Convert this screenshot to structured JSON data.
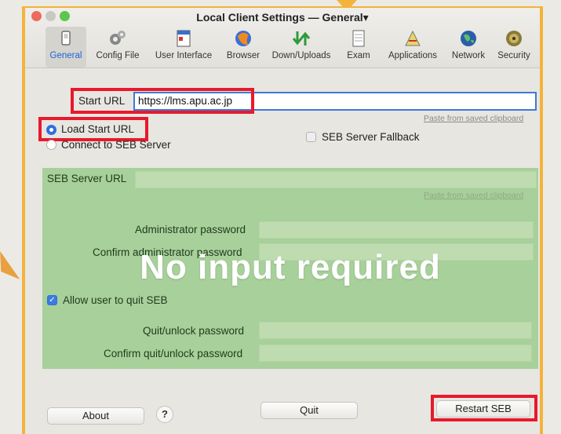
{
  "window": {
    "title": "Local Client Settings — General▾"
  },
  "toolbar": {
    "items": [
      {
        "label": "General",
        "icon": "general-icon",
        "active": true
      },
      {
        "label": "Config File",
        "icon": "config-file-icon"
      },
      {
        "label": "User Interface",
        "icon": "user-interface-icon"
      },
      {
        "label": "Browser",
        "icon": "browser-icon"
      },
      {
        "label": "Down/Uploads",
        "icon": "down-uploads-icon"
      },
      {
        "label": "Exam",
        "icon": "exam-icon"
      },
      {
        "label": "Applications",
        "icon": "applications-icon"
      },
      {
        "label": "Network",
        "icon": "network-icon"
      },
      {
        "label": "Security",
        "icon": "security-icon"
      }
    ]
  },
  "general": {
    "start_url_label": "Start URL",
    "start_url_value": "https://lms.apu.ac.jp",
    "paste_link": "Paste from saved clipboard",
    "load_start_url": "Load Start URL",
    "connect_seb_server": "Connect to SEB Server",
    "seb_server_fallback": "SEB Server Fallback"
  },
  "server": {
    "url_label": "SEB Server URL",
    "paste_link": "Paste from saved clipboard",
    "admin_password_label": "Administrator password",
    "confirm_admin_label": "Confirm administrator password",
    "allow_quit_label": "Allow user to quit SEB",
    "quit_password_label": "Quit/unlock password",
    "confirm_quit_label": "Confirm quit/unlock password"
  },
  "overlay_text": "No input required",
  "buttons": {
    "about": "About",
    "help": "?",
    "quit": "Quit",
    "restart": "Restart SEB"
  },
  "colors": {
    "accent": "#2f6fe0",
    "highlight_red": "#e8192c",
    "green_overlay": "#a8d09a",
    "frame_orange": "#f3b33c"
  }
}
